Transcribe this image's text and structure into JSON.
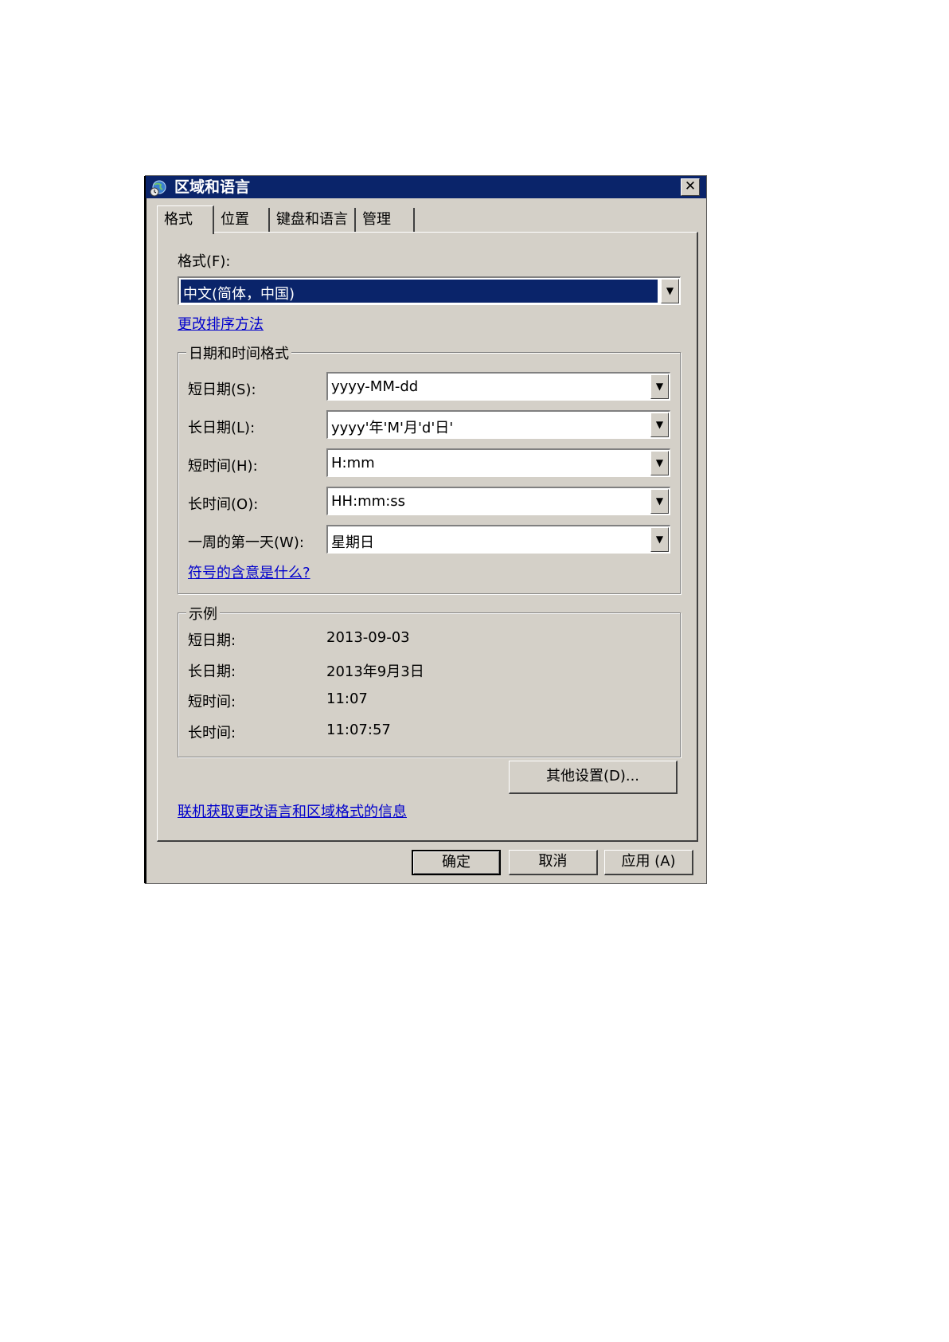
{
  "window": {
    "title": "区域和语言",
    "icon": "globe-clock-icon",
    "close": "✕"
  },
  "tabs": [
    {
      "label": "格式",
      "active": true
    },
    {
      "label": "位置",
      "active": false
    },
    {
      "label": "键盘和语言",
      "active": false
    },
    {
      "label": "管理",
      "active": false
    }
  ],
  "format": {
    "label": "格式(F):",
    "value": "中文(简体，中国)",
    "change_sort_link": "更改排序方法"
  },
  "datetime_group": {
    "title": "日期和时间格式",
    "short_date": {
      "label": "短日期(S):",
      "value": "yyyy-MM-dd"
    },
    "long_date": {
      "label": "长日期(L):",
      "value": "yyyy'年'M'月'd'日'"
    },
    "short_time": {
      "label": "短时间(H):",
      "value": "H:mm"
    },
    "long_time": {
      "label": "长时间(O):",
      "value": "HH:mm:ss"
    },
    "first_day": {
      "label": "一周的第一天(W):",
      "value": "星期日"
    },
    "symbols_link": "符号的含意是什么?"
  },
  "example_group": {
    "title": "示例",
    "rows": [
      {
        "label": "短日期:",
        "value": "2013-09-03"
      },
      {
        "label": "长日期:",
        "value": "2013年9月3日"
      },
      {
        "label": "短时间:",
        "value": "11:07"
      },
      {
        "label": "长时间:",
        "value": "11:07:57"
      }
    ]
  },
  "other_settings_button": "其他设置(D)...",
  "online_info_link": "联机获取更改语言和区域格式的信息",
  "footer": {
    "ok": "确定",
    "cancel": "取消",
    "apply": "应用 (A)"
  },
  "arrow_glyph": "▼"
}
